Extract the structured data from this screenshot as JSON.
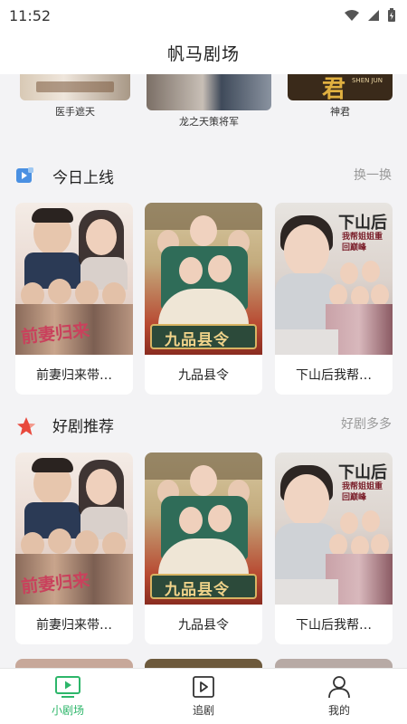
{
  "status": {
    "time": "11:52"
  },
  "header": {
    "title": "帆马剧场"
  },
  "top_row": [
    {
      "label": "医手遮天"
    },
    {
      "label": "龙之天策将军"
    },
    {
      "label": "神君",
      "poster_char": "君",
      "poster_tag": "SHEN JUN"
    }
  ],
  "sections": [
    {
      "title": "今日上线",
      "more": "换一换",
      "cards": [
        {
          "title": "前妻归来带…",
          "poster_text": "前妻归来"
        },
        {
          "title": "九品县令",
          "poster_text": "九品县令"
        },
        {
          "title": "下山后我帮…",
          "poster_text": "下山后",
          "poster_sub": "我帮姐姐重回巅峰"
        }
      ]
    },
    {
      "title": "好剧推荐",
      "more": "好剧多多",
      "cards": [
        {
          "title": "前妻归来带…",
          "poster_text": "前妻归来"
        },
        {
          "title": "九品县令",
          "poster_text": "九品县令"
        },
        {
          "title": "下山后我帮…",
          "poster_text": "下山后",
          "poster_sub": "我帮姐姐重回巅峰"
        }
      ]
    }
  ],
  "tabbar": [
    {
      "label": "小剧场",
      "icon": "tv-icon",
      "active": true
    },
    {
      "label": "追剧",
      "icon": "play-icon",
      "active": false
    },
    {
      "label": "我的",
      "icon": "user-icon",
      "active": false
    }
  ],
  "colors": {
    "accent": "#2db66a",
    "more_text": "#9a9a9a",
    "section_icon_blue": "#4a90e2",
    "section_icon_red": "#e8483c"
  }
}
